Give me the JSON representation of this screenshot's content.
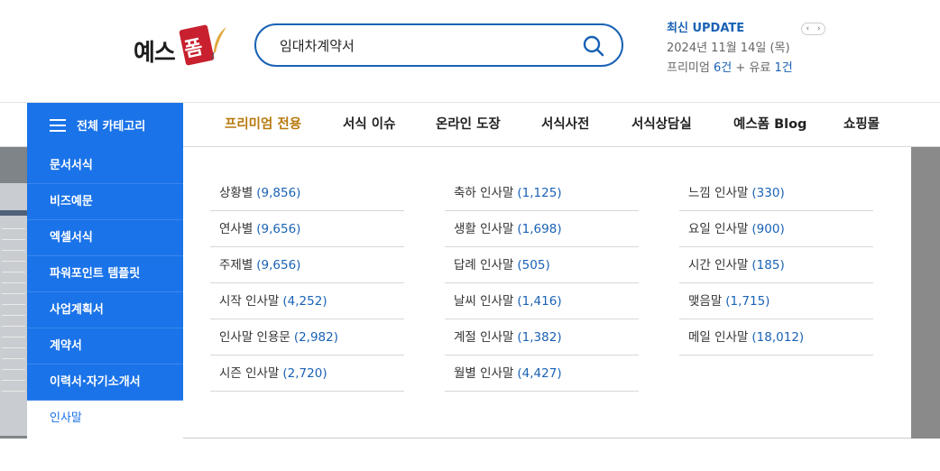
{
  "header": {
    "logo": {
      "part1": "예스",
      "part2": "폼"
    },
    "search": {
      "value": "임대차계약서",
      "placeholder": ""
    },
    "update": {
      "title": "최신 UPDATE",
      "date": "2024년 11월 14일 (목)",
      "count_prefix": "프리미엄 ",
      "count_premium": "6건",
      "count_mid": " + 유료 ",
      "count_paid": "1건"
    },
    "pager": {
      "prev": "‹",
      "next": "›"
    }
  },
  "nav": {
    "all_category": "전체 카테고리",
    "menus": [
      "프리미엄 전용",
      "서식 이슈",
      "온라인 도장",
      "서식사전",
      "서식상담실",
      "예스폼 Blog",
      "쇼핑몰"
    ]
  },
  "sidebar": {
    "items": [
      "문서서식",
      "비즈예문",
      "엑셀서식",
      "파워포인트 템플릿",
      "사업계획서",
      "계약서",
      "이력서·자기소개서",
      "인사말"
    ],
    "active_index": 7
  },
  "submenu": {
    "columns": [
      [
        {
          "label": "상황별",
          "count": "(9,856)"
        },
        {
          "label": "연사별",
          "count": "(9,656)"
        },
        {
          "label": "주제별",
          "count": "(9,656)"
        },
        {
          "label": "시작 인사말",
          "count": "(4,252)"
        },
        {
          "label": "인사말 인용문",
          "count": "(2,982)"
        },
        {
          "label": "시즌 인사말",
          "count": "(2,720)"
        }
      ],
      [
        {
          "label": "축하 인사말",
          "count": "(1,125)"
        },
        {
          "label": "생활 인사말",
          "count": "(1,698)"
        },
        {
          "label": "답례 인사말",
          "count": "(505)"
        },
        {
          "label": "날씨 인사말",
          "count": "(1,416)"
        },
        {
          "label": "계절 인사말",
          "count": "(1,382)"
        },
        {
          "label": "월별 인사말",
          "count": "(4,427)"
        }
      ],
      [
        {
          "label": "느낌 인사말",
          "count": "(330)"
        },
        {
          "label": "요일 인사말",
          "count": "(900)"
        },
        {
          "label": "시간 인사말",
          "count": "(185)"
        },
        {
          "label": "맺음말",
          "count": "(1,715)"
        },
        {
          "label": "메일 인사말",
          "count": "(18,012)"
        }
      ]
    ]
  },
  "colors": {
    "primary": "#1a73e8",
    "premium": "#b8790c",
    "link": "#1a62b5",
    "logo_red": "#c8202f"
  }
}
